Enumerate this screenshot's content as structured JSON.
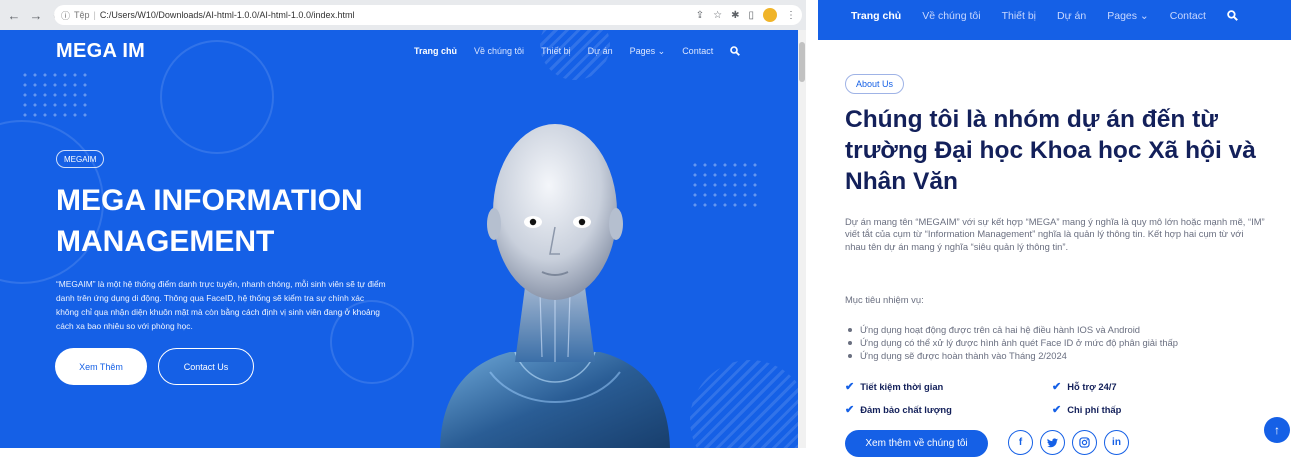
{
  "browser": {
    "back_icon": "←",
    "forward_icon": "→",
    "reload_icon": "C",
    "info_icon": "ⓘ",
    "site_label": "Tệp",
    "separator": "|",
    "url": "C:/Users/W10/Downloads/AI-html-1.0.0/AI-html-1.0.0/index.html",
    "share_icon": "⇪",
    "star_icon": "☆",
    "extension_icon": "✱",
    "sidepanel_icon": "▯",
    "menu_icon": "⋮"
  },
  "site": {
    "brand": "MEGA IM",
    "nav": [
      "Trang chủ",
      "Về chúng tôi",
      "Thiết bị",
      "Dự án",
      "Pages ⌄",
      "Contact"
    ],
    "search_icon": "🔍"
  },
  "hero": {
    "badge": "MEGAIM",
    "title": "MEGA INFORMATION MANAGEMENT",
    "description": "“MEGAIM” là một hệ thống điểm danh trực tuyến, nhanh chóng, mỗi sinh viên sẽ tự điểm danh trên ứng dụng di động. Thông qua FaceID, hệ thống sẽ kiểm tra sự chính xác không chỉ qua nhận diện khuôn mặt mà còn bằng cách định vị sinh viên đang ở khoảng cách xa bao nhiêu so với phòng học.",
    "btn_more": "Xem Thêm",
    "btn_contact": "Contact Us"
  },
  "about": {
    "nav": [
      "Trang chủ",
      "Về chúng tôi",
      "Thiết bị",
      "Dự án",
      "Pages ⌄",
      "Contact"
    ],
    "badge": "About Us",
    "title": "Chúng tôi là nhóm dự án đến từ trường Đại học Khoa học Xã hội và Nhân Văn",
    "description": "Dự án mang tên “MEGAIM” với sự kết hợp “MEGA” mang ý nghĩa là quy mô lớn hoặc mạnh mẽ, “IM” viết tắt của cụm từ “Information Management” nghĩa là quản lý thông tin. Kết hợp hai cụm từ với nhau tên dự án mang ý nghĩa “siêu quản lý thông tin”.",
    "mission_label": "Mục tiêu nhiệm vụ:",
    "missions": [
      "Ứng dụng hoạt động được trên cả hai hệ điều hành IOS và Android",
      "Ứng dụng có thể xử lý được hình ảnh quét Face ID ở mức độ phân giải thấp",
      "Ứng dụng sẽ được hoàn thành vào Tháng 2/2024"
    ],
    "features": [
      "Tiết kiệm thời gian",
      "Hỗ trợ 24/7",
      "Đảm bảo chất lượng",
      "Chi phí thấp"
    ],
    "check_icon": "✔",
    "btn_more": "Xem thêm về chúng tôi",
    "social": [
      "f",
      "t",
      "◎",
      "in"
    ],
    "back_to_top": "↑"
  },
  "colors": {
    "primary": "#1560e6",
    "heading": "#13205a",
    "body_text": "#6a6f80"
  }
}
